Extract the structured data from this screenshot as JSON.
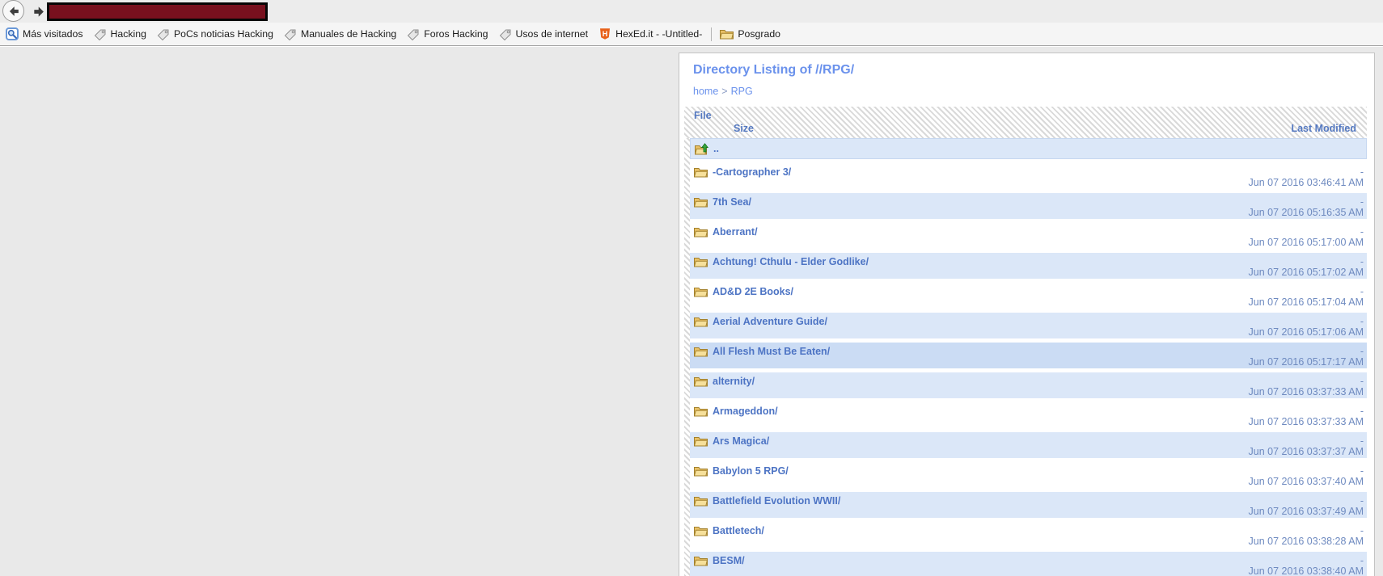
{
  "browser": {
    "navbar": {
      "back_button": "back",
      "forward_button": "forward",
      "address_bar": ""
    },
    "bookmarks": [
      {
        "label": "Más visitados",
        "icon": "most-visited-icon"
      },
      {
        "label": "Hacking",
        "icon": "tag-icon"
      },
      {
        "label": "PoCs noticias Hacking",
        "icon": "tag-icon"
      },
      {
        "label": "Manuales de Hacking",
        "icon": "tag-icon"
      },
      {
        "label": "Foros Hacking",
        "icon": "tag-icon"
      },
      {
        "label": "Usos de internet",
        "icon": "tag-icon"
      },
      {
        "label": "HexEd.it - -Untitled-",
        "icon": "hexedit-shield-icon"
      },
      {
        "label": "Posgrado",
        "icon": "folder-icon"
      }
    ]
  },
  "page": {
    "title": "Directory Listing of //RPG/",
    "breadcrumb": {
      "home": "home",
      "separator": ">",
      "current": "RPG"
    },
    "listing": {
      "header": {
        "file": "File",
        "size": "Size",
        "last_modified": "Last Modified"
      },
      "parent": {
        "label": "..",
        "icon": "parent-folder-up-icon"
      },
      "rows": [
        {
          "name": "-Cartographer 3/",
          "size": "-",
          "modified": "Jun 07 2016 03:46:41 AM",
          "shade": "white"
        },
        {
          "name": "7th Sea/",
          "size": "-",
          "modified": "Jun 07 2016 05:16:35 AM",
          "shade": "blue"
        },
        {
          "name": "Aberrant/",
          "size": "-",
          "modified": "Jun 07 2016 05:17:00 AM",
          "shade": "white"
        },
        {
          "name": "Achtung! Cthulu - Elder Godlike/",
          "size": "-",
          "modified": "Jun 07 2016 05:17:02 AM",
          "shade": "blue"
        },
        {
          "name": "AD&D 2E Books/",
          "size": "-",
          "modified": "Jun 07 2016 05:17:04 AM",
          "shade": "white"
        },
        {
          "name": "Aerial Adventure Guide/",
          "size": "-",
          "modified": "Jun 07 2016 05:17:06 AM",
          "shade": "blue"
        },
        {
          "name": "All Flesh Must Be Eaten/",
          "size": "-",
          "modified": "Jun 07 2016 05:17:17 AM",
          "shade": "row-hover"
        },
        {
          "name": "alternity/",
          "size": "-",
          "modified": "Jun 07 2016 03:37:33 AM",
          "shade": "blue"
        },
        {
          "name": "Armageddon/",
          "size": "-",
          "modified": "Jun 07 2016 03:37:33 AM",
          "shade": "white"
        },
        {
          "name": "Ars Magica/",
          "size": "-",
          "modified": "Jun 07 2016 03:37:37 AM",
          "shade": "blue"
        },
        {
          "name": "Babylon 5 RPG/",
          "size": "-",
          "modified": "Jun 07 2016 03:37:40 AM",
          "shade": "white"
        },
        {
          "name": "Battlefield Evolution WWII/",
          "size": "-",
          "modified": "Jun 07 2016 03:37:49 AM",
          "shade": "blue"
        },
        {
          "name": "Battletech/",
          "size": "-",
          "modified": "Jun 07 2016 03:38:28 AM",
          "shade": "white"
        },
        {
          "name": "BESM/",
          "size": "-",
          "modified": "Jun 07 2016 03:38:40 AM",
          "shade": "blue"
        }
      ]
    }
  },
  "colors": {
    "title_blue": "#6b92ec",
    "link_blue": "#4d74c4",
    "header_blue": "#5579c1",
    "meta_blue": "#6e8ac0",
    "row_blue": "#dbe7f8",
    "row_hover_blue": "#cbdcf4",
    "redacted_fill": "#78101e",
    "page_gray": "#e9e9e9"
  }
}
